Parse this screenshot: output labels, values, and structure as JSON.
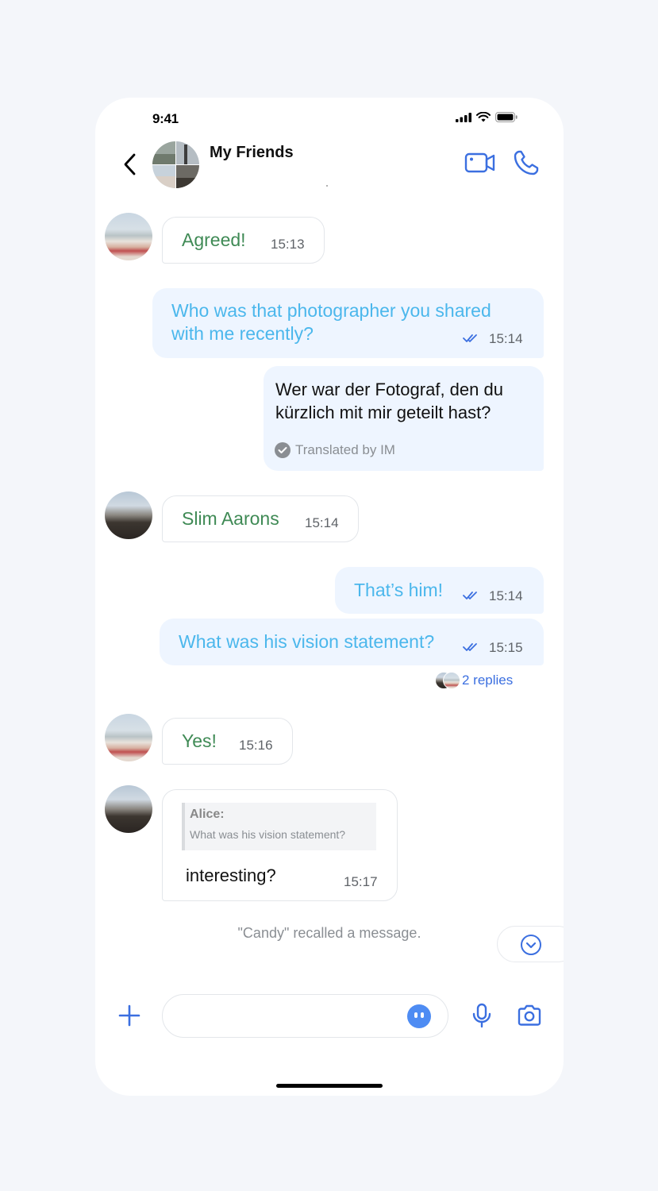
{
  "status": {
    "time": "9:41"
  },
  "header": {
    "title": "My Friends",
    "back_icon": "chevron-left-icon",
    "video_icon": "video-camera-icon",
    "call_icon": "phone-icon"
  },
  "messages": [
    {
      "id": "m1",
      "direction": "in",
      "text": "Agreed!",
      "time": "15:13"
    },
    {
      "id": "m2",
      "direction": "out",
      "text": "Who was that photographer you shared with me recently?",
      "time": "15:14",
      "read": true
    },
    {
      "id": "m2t",
      "direction": "out",
      "type": "translation",
      "text": "Wer war der Fotograf, den du kürzlich mit mir geteilt hast?",
      "footer": "Translated by IM"
    },
    {
      "id": "m3",
      "direction": "in",
      "text": "Slim Aarons",
      "time": "15:14"
    },
    {
      "id": "m4",
      "direction": "out",
      "text": "That’s him!",
      "time": "15:14",
      "read": true
    },
    {
      "id": "m5",
      "direction": "out",
      "text": "What was his vision statement?",
      "time": "15:15",
      "read": true,
      "replies": "2 replies"
    },
    {
      "id": "m6",
      "direction": "in",
      "text": "Yes!",
      "time": "15:16"
    },
    {
      "id": "m7",
      "direction": "in",
      "quote": {
        "name": "Alice:",
        "text": "What was his vision statement?"
      },
      "text": "interesting?",
      "time": "15:17"
    }
  ],
  "system_notice": "\"Candy\" recalled a message.",
  "composer": {
    "placeholder": "",
    "plus_icon": "plus-icon",
    "emoji_icon": "emoji-icon",
    "mic_icon": "microphone-icon",
    "camera_icon": "camera-icon"
  },
  "colors": {
    "accent": "#3b6fe0",
    "incoming_text": "#3f8a55",
    "outgoing_text": "#4bb7ec",
    "outgoing_bubble": "#eef5ff"
  }
}
